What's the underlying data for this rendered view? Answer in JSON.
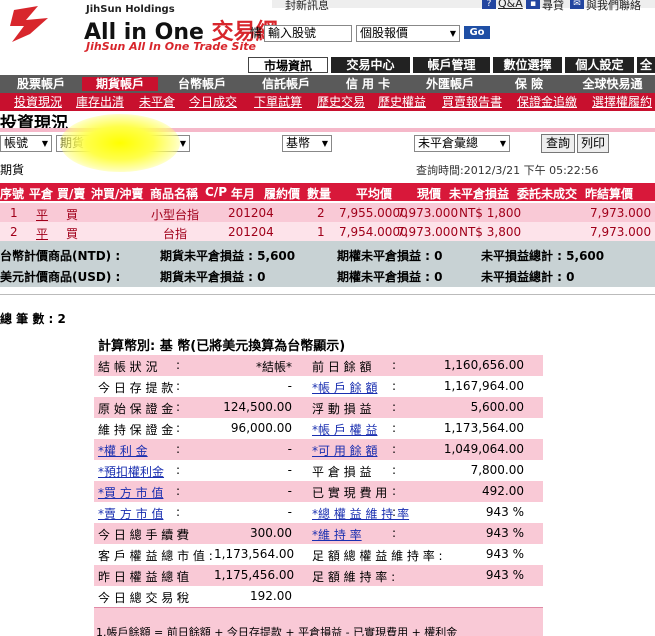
{
  "brand": {
    "holdings": "JihSun Holdings",
    "name_en": "All in One",
    "name_zh": "交易網",
    "subtitle": "JihSun All In One Trade Site"
  },
  "top_links": [
    "封新訊息",
    "Q&A",
    "尋貸",
    "與我們聯絡"
  ],
  "search": {
    "label": "情",
    "input_value": "輸入股號",
    "type_select": "個股報價",
    "go_label": "Go"
  },
  "main_menu": [
    "市場資訊",
    "交易中心",
    "帳戶管理",
    "數位選擇",
    "個人設定",
    "全"
  ],
  "nav": {
    "items": [
      "股票帳戶",
      "期貨帳戶",
      "台幣帳戶",
      "信託帳戶",
      "信 用 卡",
      "外匯帳戶",
      "保    險",
      "全球快易通"
    ],
    "active_index": 1
  },
  "sub_nav": [
    "投資現況",
    "庫存出清",
    "未平倉",
    "今日成交",
    "下單試算",
    "歷史交易",
    "歷史權益",
    "買賣報告書",
    "保證金追繳",
    "選擇權履約"
  ],
  "page_title": "投資現況",
  "filters": {
    "account_select": "帳號",
    "futures_select": "期貨",
    "currency_select": "基幣",
    "position_select": "未平倉彙總",
    "query_button": "查詢",
    "print_button": "列印",
    "account_label": "期貨",
    "query_time": "查詢時間:2012/3/21 下午 05:22:56"
  },
  "positions": {
    "headers": [
      "序號",
      "平倉",
      "買/賣",
      "沖買/沖賣",
      "商品名稱",
      "C/P",
      "年月",
      "履約價",
      "數量",
      "平均價",
      "現價",
      "未平倉損益",
      "委託未成交",
      "昨結算價"
    ],
    "rows": [
      {
        "seq": "1",
        "close": "平",
        "side": "買",
        "product": "小型台指",
        "month": "201204",
        "qty": "2",
        "avg": "7,955.0000",
        "price": "7,973.000",
        "pl": "NT$ 1,800",
        "settle": "7,973.000"
      },
      {
        "seq": "2",
        "close": "平",
        "side": "買",
        "product": "台指",
        "month": "201204",
        "qty": "1",
        "avg": "7,954.0000",
        "price": "7,973.000",
        "pl": "NT$ 3,800",
        "settle": "7,973.000"
      }
    ]
  },
  "summary": [
    {
      "label": "台幣計價商品(NTD) :",
      "fut": "期貨未平倉損益 : 5,600",
      "opt": "期權未平倉損益 : 0",
      "total": "未平損益總計 : 5,600"
    },
    {
      "label": "美元計價商品(USD) :",
      "fut": "期貨未平倉損益 : 0",
      "opt": "期權未平倉損益 : 0",
      "total": "未平損益總計 : 0"
    }
  ],
  "count_label": "總 筆 數 : 2",
  "calc_title": "計算幣別: 基 幣(已將美元換算為台幣顯示)",
  "details": [
    {
      "l": "結 帳 狀 況",
      "lv": "*結帳*",
      "r": "前 日 餘 額",
      "rv": "1,160,656.00",
      "llink": false,
      "rlink": false
    },
    {
      "l": "今 日 存 提 款",
      "lv": "-",
      "r": "*帳 戶 餘 額",
      "rv": "1,167,964.00",
      "llink": false,
      "rlink": true
    },
    {
      "l": "原 始 保 證 金",
      "lv": "124,500.00",
      "r": "浮 動 損 益",
      "rv": "5,600.00",
      "llink": false,
      "rlink": false
    },
    {
      "l": "維 持 保 證 金",
      "lv": "96,000.00",
      "r": "*帳 戶 權 益",
      "rv": "1,173,564.00",
      "llink": false,
      "rlink": true
    },
    {
      "l": "*權 利 金",
      "lv": "-",
      "r": "*可 用 餘 額",
      "rv": "1,049,064.00",
      "llink": true,
      "rlink": true
    },
    {
      "l": "*預扣權利金",
      "lv": "-",
      "r": "平 倉 損 益",
      "rv": "7,800.00",
      "llink": true,
      "rlink": false
    },
    {
      "l": "*買 方 市 值",
      "lv": "-",
      "r": "已 實 現 費 用",
      "rv": "492.00",
      "llink": true,
      "rlink": false
    },
    {
      "l": "*賣 方 市 值",
      "lv": "-",
      "r": "*總 權 益 維 持 率",
      "rv": "943  %",
      "llink": true,
      "rlink": true
    },
    {
      "l": "今 日 總 手 續 費",
      "lv": "300.00",
      "r": "*維 持 率",
      "rv": "943  %",
      "llink": false,
      "rlink": true
    },
    {
      "l": "客 戶 權 益 總 市 值 :",
      "lv": "1,173,564.00",
      "r": "足 額 總 權 益 維 持 率 :",
      "rv": "943  %",
      "llink": false,
      "rlink": false
    },
    {
      "l": "昨 日 權 益 總 值",
      "lv": "1,175,456.00",
      "r": "足 額 維 持 率 :",
      "rv": "943  %",
      "llink": false,
      "rlink": false
    },
    {
      "l": "今 日 總 交 易 稅",
      "lv": "192.00",
      "r": "",
      "rv": "",
      "llink": false,
      "rlink": false
    }
  ],
  "footnote": "1.帳戶餘額 = 前日餘額 + 今日存提款 + 平倉損益 - 已實現費用 + 權利金"
}
